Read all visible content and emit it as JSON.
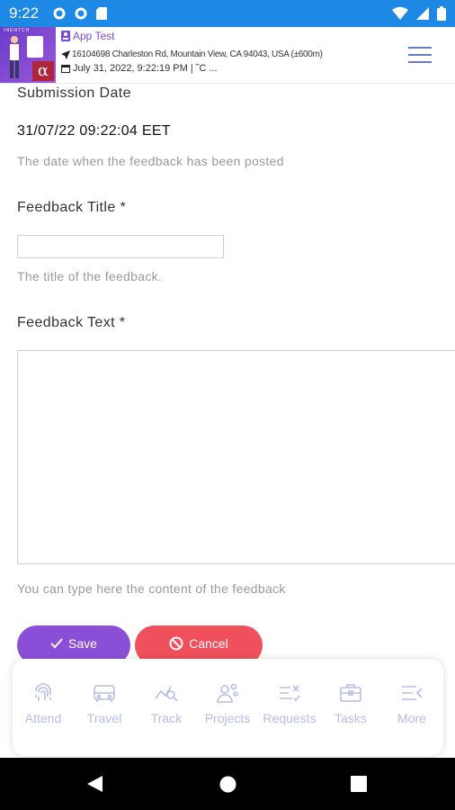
{
  "status_bar": {
    "time": "9:22",
    "icons": [
      "gear-icon",
      "gear-icon",
      "sd-card-icon",
      "wifi-icon",
      "signal-icon",
      "battery-icon"
    ]
  },
  "header": {
    "app_name": "App Test",
    "address": "16104698 Charleston Rd, Mountain View, CA 94043, USA (±600m)",
    "datetime": "July 31, 2022, 9:22:19 PM | ˜C ..."
  },
  "form": {
    "submission_date": {
      "label": "Submission Date",
      "value": "31/07/22 09:22:04 EET",
      "help": "The date when the feedback has been posted"
    },
    "feedback_title": {
      "label": "Feedback Title *",
      "value": "",
      "help": "The title of the feedback."
    },
    "feedback_text": {
      "label": "Feedback Text *",
      "value": "",
      "help": "You can type here the content of the feedback"
    },
    "save_label": "Save",
    "cancel_label": "Cancel"
  },
  "bottom_nav": {
    "items": [
      {
        "label": "Attend",
        "icon": "fingerprint-icon"
      },
      {
        "label": "Travel",
        "icon": "car-icon"
      },
      {
        "label": "Track",
        "icon": "track-icon"
      },
      {
        "label": "Projects",
        "icon": "people-icon"
      },
      {
        "label": "Requests",
        "icon": "requests-icon"
      },
      {
        "label": "Tasks",
        "icon": "briefcase-icon"
      },
      {
        "label": "More",
        "icon": "more-icon"
      }
    ]
  },
  "colors": {
    "status_bar": "#1e88e5",
    "accent_purple": "#8a4fd6",
    "cancel_red": "#f0505b",
    "nav_inactive": "#b7bde6"
  }
}
